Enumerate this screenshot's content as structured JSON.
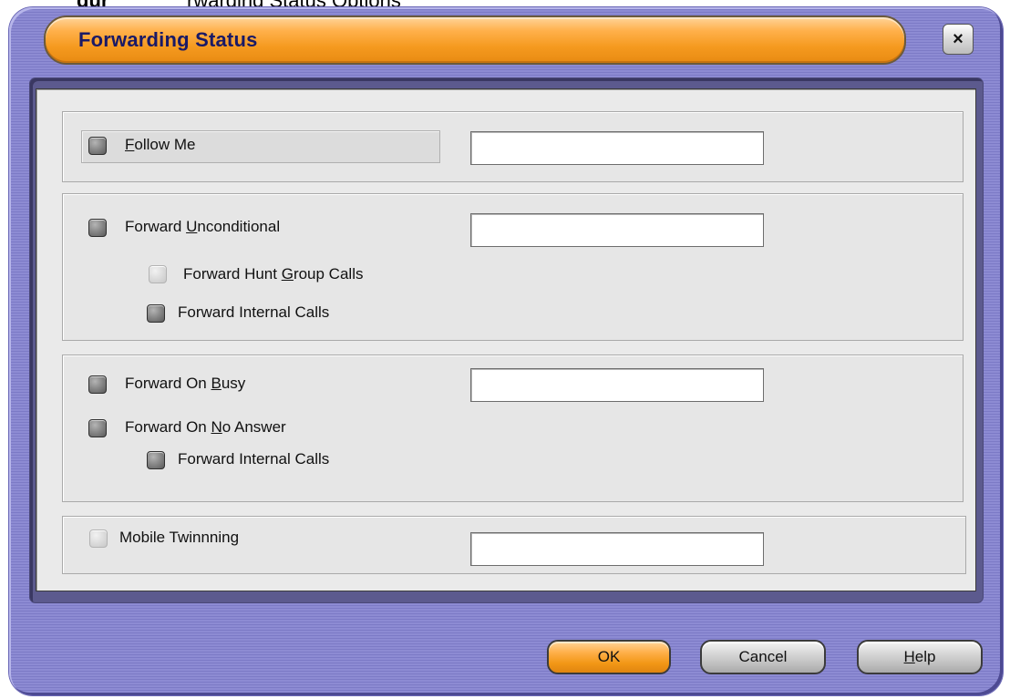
{
  "caption": {
    "prefix": "gur",
    "rest": "rwarding Status Options"
  },
  "dialog": {
    "title": "Forwarding Status",
    "close_label": "×"
  },
  "follow_me": {
    "label_pre": "",
    "label_mnemonic": "F",
    "label_post": "ollow Me",
    "value": ""
  },
  "forward_unconditional": {
    "label_pre": "Forward ",
    "label_mnemonic": "U",
    "label_post": "nconditional",
    "value": "",
    "hunt_group": {
      "label_pre": "Forward Hunt ",
      "label_mnemonic": "G",
      "label_post": "roup Calls",
      "disabled": true
    },
    "internal_calls": {
      "label": "Forward Internal Calls"
    }
  },
  "forward_busy": {
    "label_pre": "Forward On ",
    "label_mnemonic": "B",
    "label_post": "usy",
    "value": ""
  },
  "forward_no_answer": {
    "label_pre": "Forward On ",
    "label_mnemonic": "N",
    "label_post": "o Answer",
    "internal_calls": {
      "label": "Forward Internal Calls"
    }
  },
  "mobile_twinning": {
    "label": "Mobile Twinnning",
    "value": "",
    "disabled": true
  },
  "buttons": {
    "ok": "OK",
    "cancel": "Cancel",
    "help_pre": "",
    "help_mnemonic": "H",
    "help_post": "elp"
  },
  "colors": {
    "titlebar_orange": "#f59a1f",
    "frame_purple": "#8d8bd3",
    "title_text": "#1a1a66"
  }
}
